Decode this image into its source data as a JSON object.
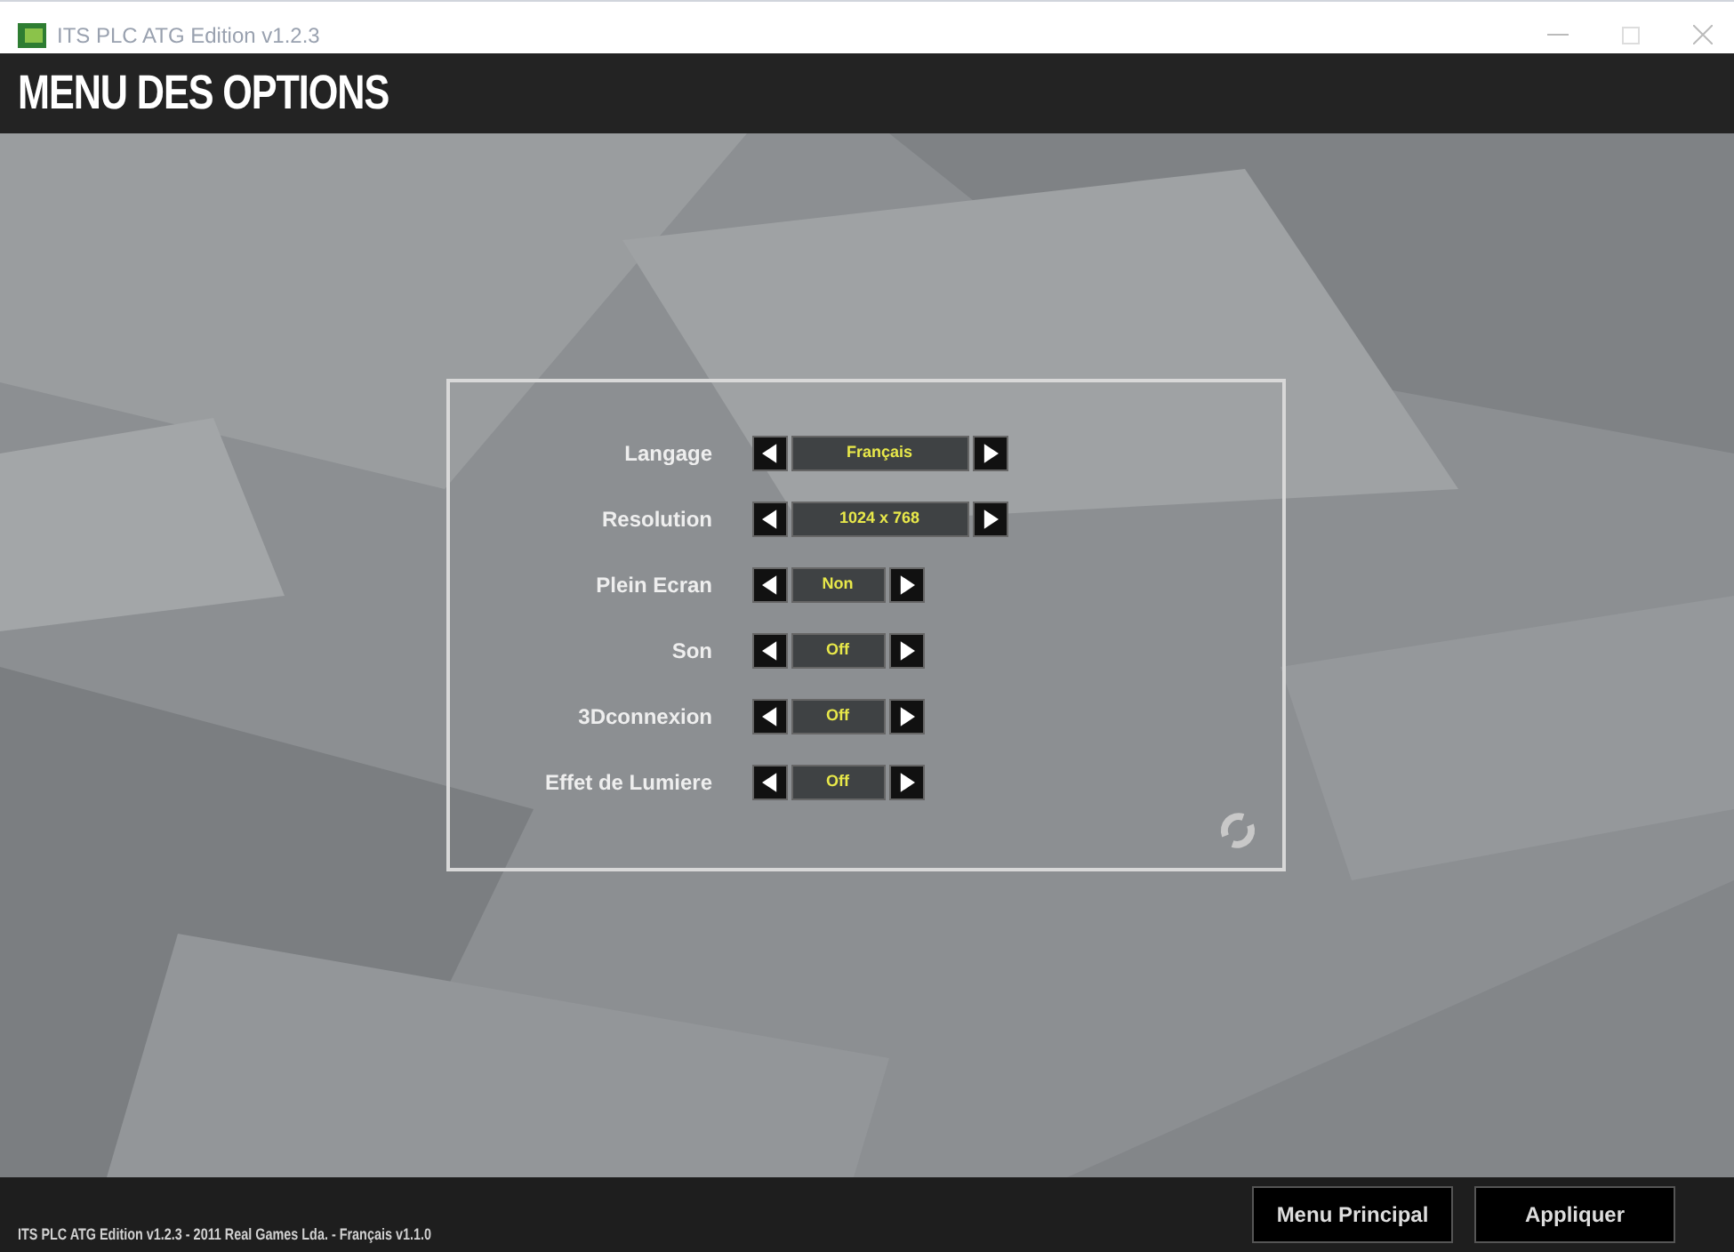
{
  "window": {
    "title": "ITS PLC ATG Edition v1.2.3"
  },
  "header": {
    "title": "MENU DES OPTIONS"
  },
  "settings": [
    {
      "label": "Langage",
      "value": "Français",
      "kind": "wide"
    },
    {
      "label": "Resolution",
      "value": "1024 x 768",
      "kind": "wide"
    },
    {
      "label": "Plein Ecran",
      "value": "Non",
      "kind": "narrow"
    },
    {
      "label": "Son",
      "value": "Off",
      "kind": "narrow"
    },
    {
      "label": "3Dconnexion",
      "value": "Off",
      "kind": "narrow"
    },
    {
      "label": "Effet de Lumiere",
      "value": "Off",
      "kind": "narrow"
    }
  ],
  "footer": {
    "version": "ITS PLC ATG Edition v1.2.3 - 2011 Real Games Lda. - Français v1.1.0",
    "buttons": [
      "Menu Principal",
      "Appliquer"
    ]
  }
}
